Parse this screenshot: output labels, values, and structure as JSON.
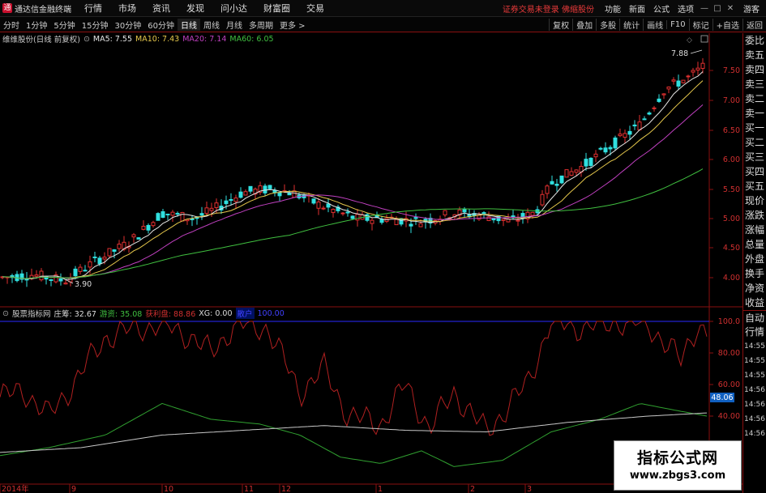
{
  "app": {
    "title": "通达信金融终端",
    "logo_char": "通"
  },
  "menu": [
    "行情",
    "市场",
    "资讯",
    "发现",
    "问小达",
    "财富圈",
    "交易"
  ],
  "notice": "证券交易未登录  佛缩股份",
  "right_menu": [
    "功能",
    "新面",
    "公式",
    "选项"
  ],
  "account": "游客",
  "periods": [
    "分时",
    "1分钟",
    "5分钟",
    "15分钟",
    "30分钟",
    "60分钟",
    "日线",
    "周线",
    "月线",
    "多周期",
    "更多 >"
  ],
  "active_period": "日线",
  "tools_right": [
    "复权",
    "叠加",
    "多股",
    "统计",
    "画线",
    "F10",
    "标记",
    "+自选",
    "返回"
  ],
  "chart_header": {
    "title": "维维股份(日线 前复权)",
    "ma": [
      {
        "label": "MA5: 7.55",
        "color": "#e6e6e6"
      },
      {
        "label": "MA10: 7.43",
        "color": "#e6c84c"
      },
      {
        "label": "MA20: 7.14",
        "color": "#c040c0"
      },
      {
        "label": "MA60: 6.05",
        "color": "#40c040"
      }
    ]
  },
  "indicator_header": {
    "title": "股票指标网",
    "items": [
      {
        "label": "庄筹: 32.67",
        "color": "#dddddd"
      },
      {
        "label": "游资: 35.08",
        "color": "#40c040"
      },
      {
        "label": "获利盘: 88.86",
        "color": "#d03030"
      },
      {
        "label": "XG: 0.00",
        "color": "#dddddd"
      },
      {
        "label": "散户",
        "color": "#4040ff"
      },
      {
        "label": "100.00",
        "color": "#4040ff"
      }
    ]
  },
  "price_labels": {
    "high": "7.88",
    "low": "3.90"
  },
  "y_axis_price": [
    "7.50",
    "7.00",
    "6.50",
    "6.00",
    "5.50",
    "5.00",
    "4.50",
    "4.00"
  ],
  "y_axis_ind": [
    "100.0",
    "80.00",
    "60.00",
    "40.00"
  ],
  "current_ind_value": "48.06",
  "side_panel": [
    "委比",
    "卖五",
    "卖四",
    "卖三",
    "卖二",
    "卖一",
    "买一",
    "买二",
    "买三",
    "买四",
    "买五",
    "现价",
    "涨跌",
    "涨幅",
    "总量",
    "外盘",
    "换手",
    "净资",
    "收益",
    "自动",
    "行情"
  ],
  "time_labels_right": [
    "14:55",
    "14:55",
    "14:55",
    "14:56",
    "14:56",
    "14:56",
    "14:56"
  ],
  "x_axis": [
    "2014年",
    "9",
    "10",
    "11",
    "12",
    "1",
    "2",
    "3"
  ],
  "watermark": {
    "title": "指标公式网",
    "url": "www.zbgs3.com"
  },
  "colors": {
    "up": "#e03030",
    "down": "#30e0e0",
    "ma5": "#e6e6e6",
    "ma10": "#e6c84c",
    "ma20": "#c040c0",
    "ma60": "#40c040",
    "ind_red": "#b02020",
    "ind_green": "#30a030",
    "ind_white": "#c8c8c8",
    "border": "#8a0f0f"
  }
}
